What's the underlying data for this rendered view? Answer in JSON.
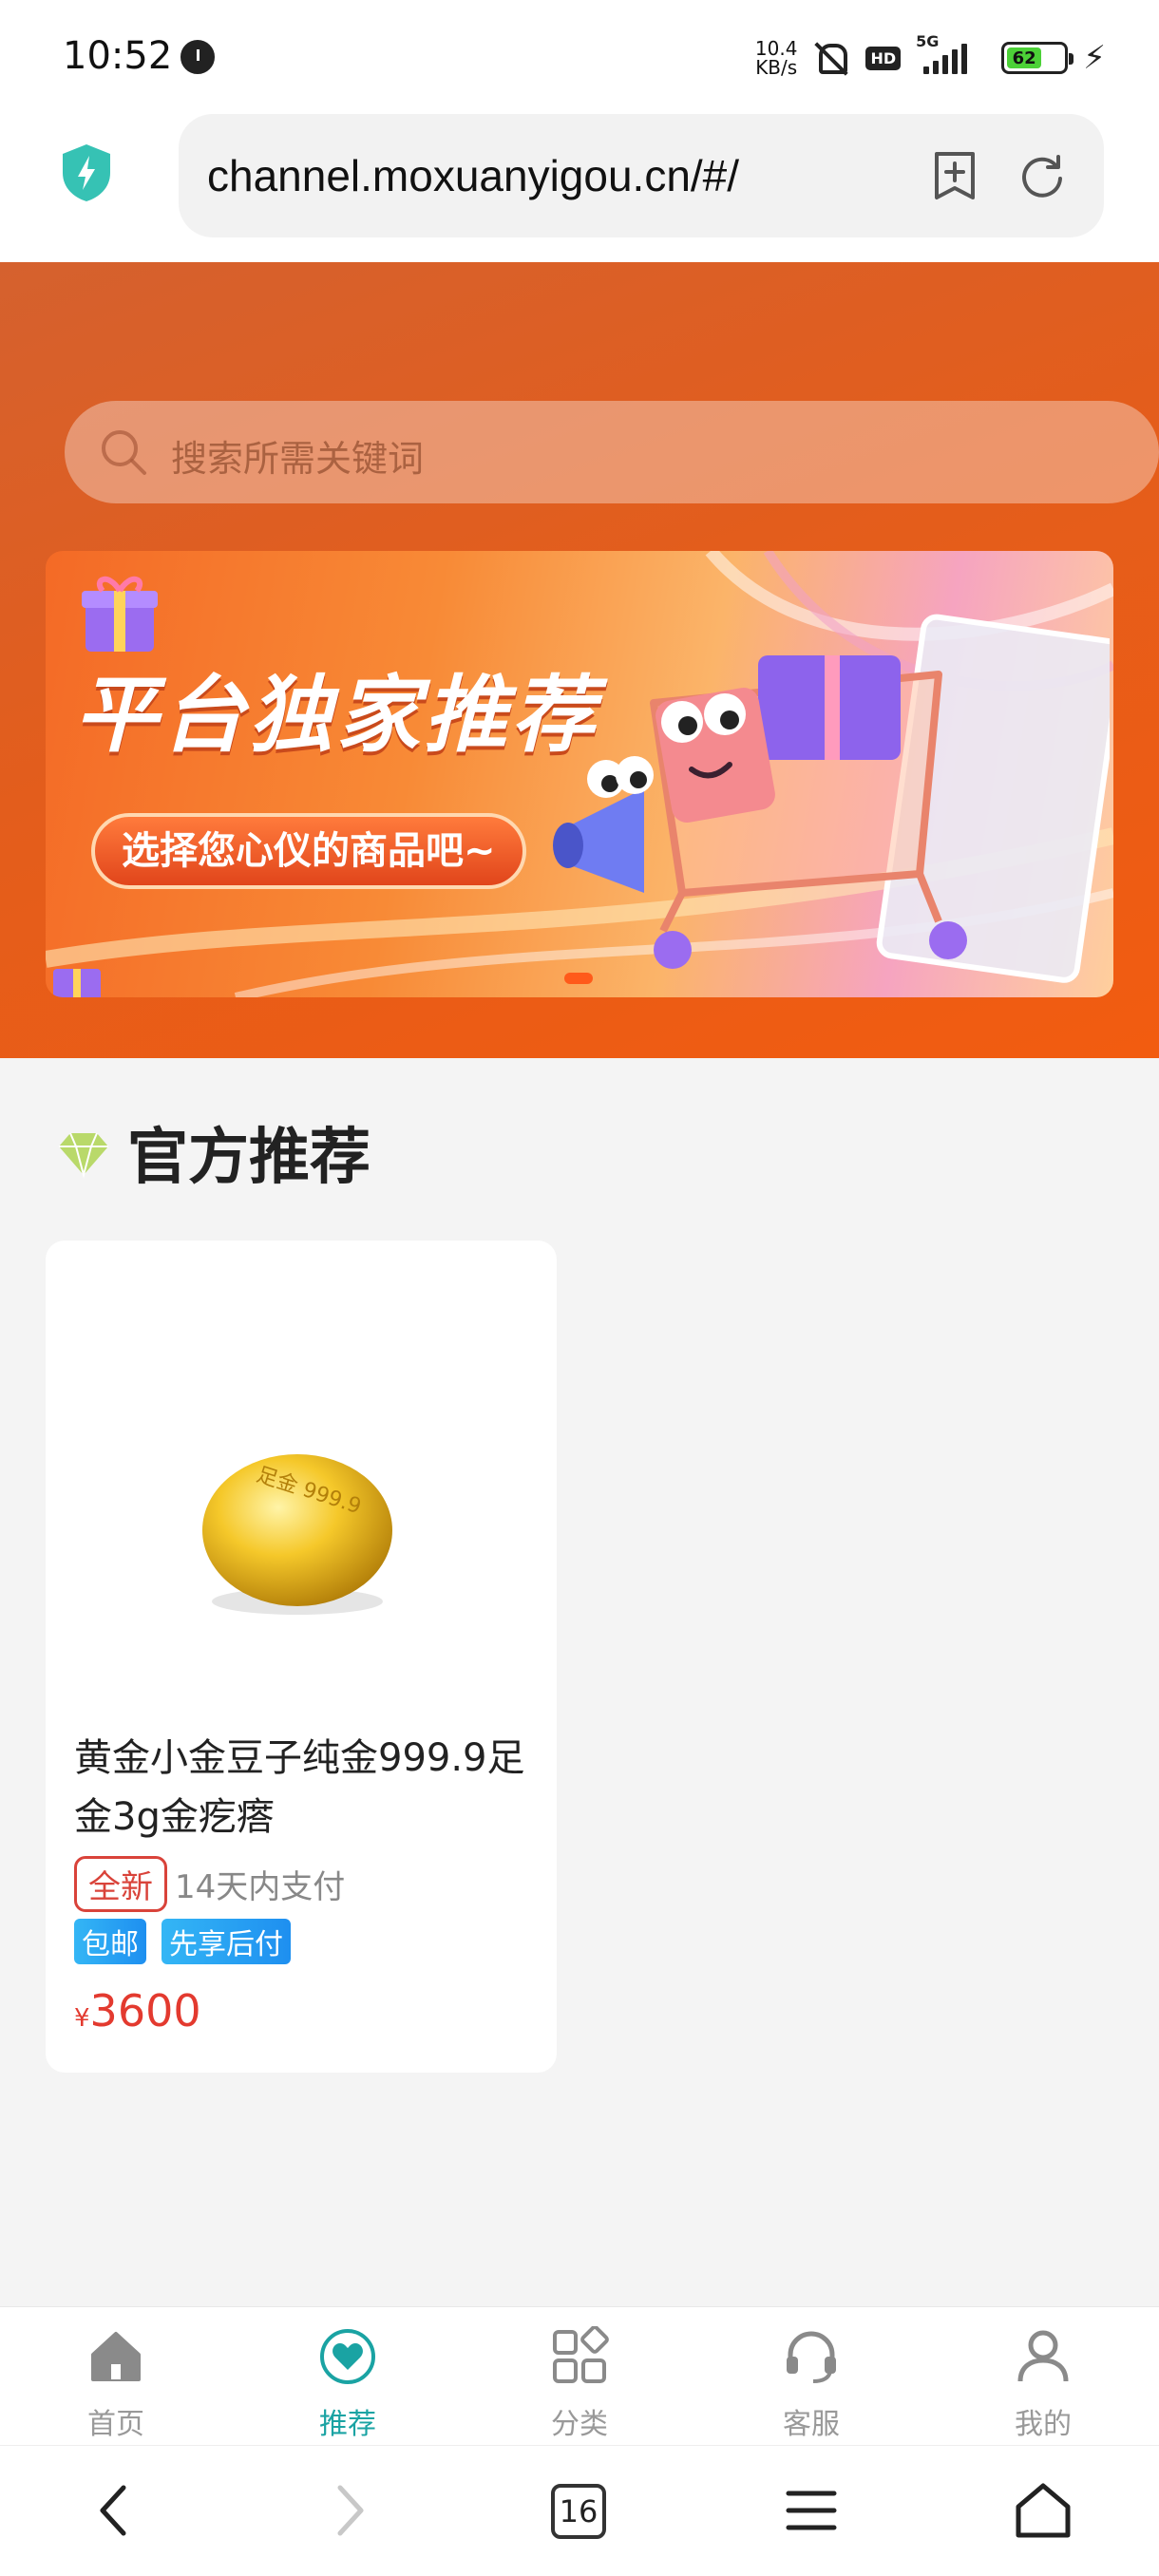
{
  "status_bar": {
    "time": "10:52",
    "net_speed_value": "10.4",
    "net_speed_unit": "KB/s",
    "hd": "HD",
    "network": "5G",
    "battery": "62"
  },
  "browser": {
    "url": "channel.moxuanyigou.cn/#/"
  },
  "search": {
    "placeholder": "搜索所需关键词"
  },
  "banner": {
    "title": "平台独家推荐",
    "cta": "选择您心仪的商品吧~"
  },
  "section": {
    "title": "官方推荐"
  },
  "products": [
    {
      "name": "黄金小金豆子纯金999.9足金3g金疙瘩",
      "condition_tag": "全新",
      "payment_note": "14天内支付",
      "badges": [
        "包邮",
        "先享后付"
      ],
      "currency": "¥",
      "price": "3600",
      "image_engraving": "足金 999.9"
    }
  ],
  "tab_bar": {
    "items": [
      {
        "label": "首页",
        "icon": "home-icon",
        "active": false
      },
      {
        "label": "推荐",
        "icon": "heart-icon",
        "active": true
      },
      {
        "label": "分类",
        "icon": "category-icon",
        "active": false
      },
      {
        "label": "客服",
        "icon": "headset-icon",
        "active": false
      },
      {
        "label": "我的",
        "icon": "user-icon",
        "active": false
      }
    ],
    "active_color": "#1aa3a3",
    "inactive_color": "#999999"
  },
  "system_nav": {
    "tabs_count": "16"
  },
  "colors": {
    "hero_orange": "#e35d1c",
    "price_red": "#e33a2f",
    "badge_blue": "#1e8ff0",
    "shield_teal": "#36c2b4"
  }
}
